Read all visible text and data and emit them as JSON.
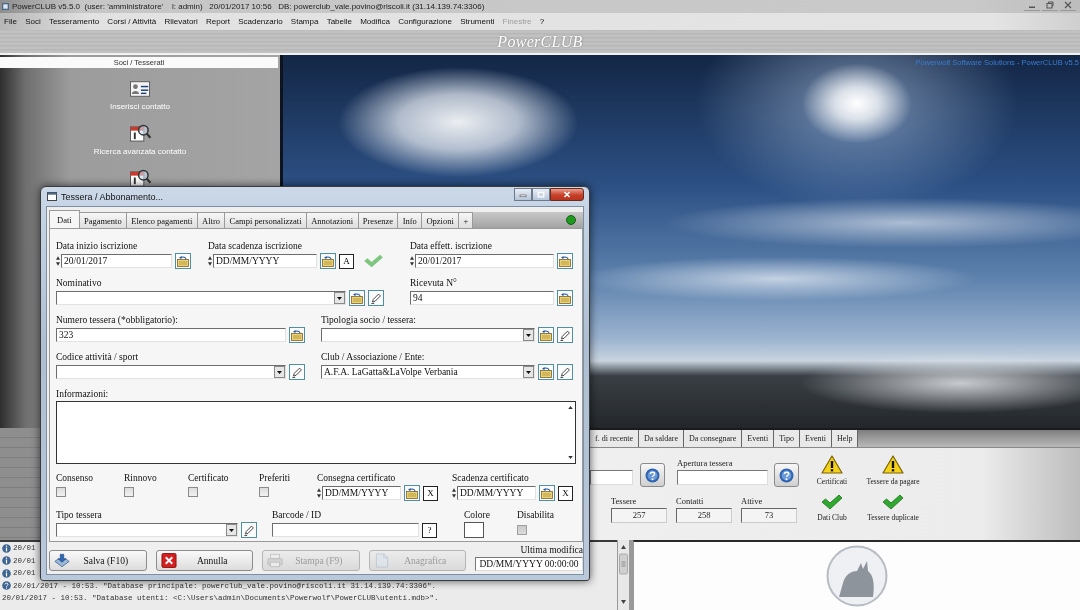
{
  "window": {
    "title": "PowerCLUB v5.5.0  (user: 'amministratore'    l: admin)   20/01/2017 10:56   DB: powerclub_vale.povino@riscoli.it (31.14.139.74:3306)"
  },
  "menu": [
    {
      "label": "File",
      "disabled": false
    },
    {
      "label": "Soci",
      "disabled": false
    },
    {
      "label": "Tesseramento",
      "disabled": false
    },
    {
      "label": "Corsi / Attività",
      "disabled": false
    },
    {
      "label": "Rilevatori",
      "disabled": false
    },
    {
      "label": "Report",
      "disabled": false
    },
    {
      "label": "Scadenzario",
      "disabled": false
    },
    {
      "label": "Stampa",
      "disabled": false
    },
    {
      "label": "Tabelle",
      "disabled": false
    },
    {
      "label": "Modifica",
      "disabled": false
    },
    {
      "label": "Configurazione",
      "disabled": false
    },
    {
      "label": "Strumenti",
      "disabled": false
    },
    {
      "label": "Finestre",
      "disabled": true
    },
    {
      "label": "?",
      "disabled": false
    }
  ],
  "banner": {
    "title": "PowerCLUB"
  },
  "sidebar": {
    "title": "Soci / Tesserati",
    "items": [
      {
        "kind": "card",
        "label": "Inserisci contatto"
      },
      {
        "kind": "search",
        "label": "Ricerca avanzata contatto"
      },
      {
        "kind": "search"
      }
    ]
  },
  "background": {
    "caption": "Powerwolf Software Solutions - PowerCLUB v5.5"
  },
  "dashboard": {
    "tabs": [
      {
        "label": "f. di recente",
        "selected": false
      },
      {
        "label": "Da saldare",
        "selected": false
      },
      {
        "label": "Da consegnare",
        "selected": false
      },
      {
        "label": "Eventi",
        "selected": false
      },
      {
        "label": "Tipo",
        "selected": false
      },
      {
        "label": "Eventi",
        "selected": false
      },
      {
        "label": "Help",
        "selected": false
      }
    ],
    "opening": {
      "label": "Apertura tessera"
    },
    "stats": [
      {
        "label": "Tessere",
        "value": "257"
      },
      {
        "label": "Contatti",
        "value": "258"
      },
      {
        "label": "Attive",
        "value": "73"
      }
    ],
    "alerts": [
      {
        "kind": "warning",
        "label": "Certificati"
      },
      {
        "kind": "warning",
        "label": "Tessere da pagare"
      },
      {
        "kind": "ok",
        "label": "Dati Club"
      },
      {
        "kind": "ok",
        "label": "Tessere duplicate"
      }
    ]
  },
  "log": {
    "entries": [
      {
        "kind": "info",
        "text": "20/01"
      },
      {
        "kind": "info",
        "text": "20/01"
      },
      {
        "kind": "info",
        "text": "20/01"
      },
      {
        "kind": "help",
        "text": "20/01/2017 - 10:53. \"Database principale: powerclub_vale.povino@riscoli.it 31.14.139.74:3306\"."
      },
      {
        "kind": "plain",
        "text": "20/01/2017 - 10:53. \"Database utenti: <C:\\Users\\admin\\Documents\\Powerwolf\\PowerCLUB\\utenti.mdb>\"."
      }
    ]
  },
  "dialog": {
    "title": "Tessera / Abbonamento...",
    "tabs": [
      {
        "label": "Dati",
        "selected": true
      },
      {
        "label": "Pagamento",
        "selected": false
      },
      {
        "label": "Elenco pagamenti",
        "selected": false
      },
      {
        "label": "Altro",
        "selected": false
      },
      {
        "label": "Campi personalizzati",
        "selected": false
      },
      {
        "label": "Annotazioni",
        "selected": false
      },
      {
        "label": "Presenze",
        "selected": false
      },
      {
        "label": "Info",
        "selected": false
      },
      {
        "label": "Opzioni",
        "selected": false
      },
      {
        "label": "+",
        "selected": false
      }
    ],
    "status": {
      "on": true
    },
    "start_date": {
      "label": "Data inizio iscrizione",
      "value": "20/01/2017"
    },
    "end_date": {
      "label": "Data scadenza iscrizione",
      "value": "DD/MM/YYYY",
      "auto_button": "A",
      "valid": true
    },
    "effective_date": {
      "label": "Data effett. iscrizione",
      "value": "20/01/2017"
    },
    "name": {
      "label": "Nominativo"
    },
    "receipt": {
      "label": "Ricevuta N°",
      "value": "94"
    },
    "card_number": {
      "label": "Numero tessera (*obbligatorio):",
      "value": "323"
    },
    "member_type": {
      "label": "Tipologia socio / tessera:"
    },
    "activity_code": {
      "label": "Codice attività / sport"
    },
    "club": {
      "label": "Club / Associazione / Ente:",
      "value": "A.F.A. LaGatta&LaVolpe Verbania"
    },
    "notes": {
      "label": "Informazioni:"
    },
    "flags": [
      {
        "label": "Consenso",
        "checked": false
      },
      {
        "label": "Rinnovo",
        "checked": false
      },
      {
        "label": "Certificato",
        "checked": false
      },
      {
        "label": "Preferiti",
        "checked": false
      }
    ],
    "certificate_delivery": {
      "label": "Consegna certificato",
      "value": "DD/MM/YYYY",
      "clear_button": "X"
    },
    "certificate_expiry": {
      "label": "Scadenza certificato",
      "value": "DD/MM/YYYY",
      "clear_button": "X"
    },
    "card_type": {
      "label": "Tipo tessera"
    },
    "barcode": {
      "label": "Barcode / ID",
      "help_button": "?"
    },
    "color": {
      "label": "Colore"
    },
    "disable": {
      "label": "Disabilita",
      "checked": false
    },
    "buttons": [
      {
        "kind": "save",
        "label": "Salva (F10)",
        "disabled": false
      },
      {
        "kind": "cancel",
        "label": "Annulla",
        "disabled": false
      },
      {
        "kind": "print",
        "label": "Stampa (F9)",
        "disabled": true
      },
      {
        "kind": "record",
        "label": "Anagrafica",
        "disabled": true
      }
    ],
    "last_modified": {
      "label": "Ultima modifica",
      "value": "DD/MM/YYYY 00:00:00"
    }
  }
}
